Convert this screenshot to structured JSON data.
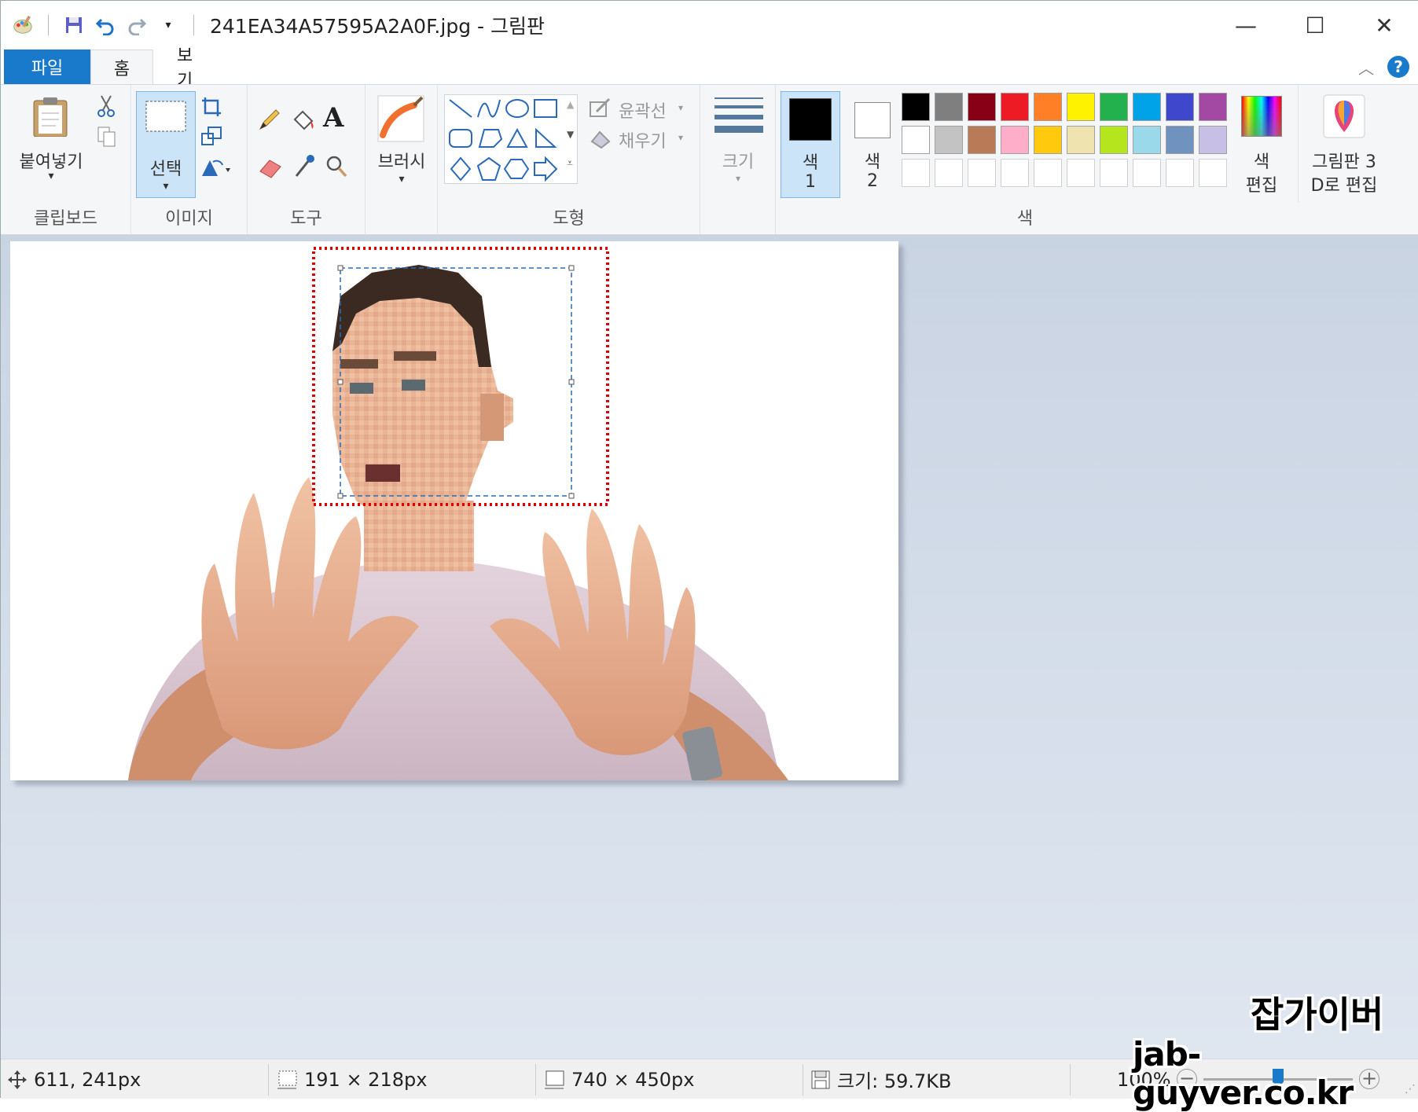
{
  "window": {
    "title": "241EA34A57595A2A0F.jpg - 그림판",
    "minimize": "—",
    "maximize": "☐",
    "close": "✕"
  },
  "tabs": {
    "file": "파일",
    "home": "홈",
    "view": "보기"
  },
  "help": "?",
  "collapse": "︿",
  "ribbon": {
    "clipboard": {
      "paste_label": "붙여넣기",
      "group": "클립보드"
    },
    "image": {
      "select_label": "선택",
      "group": "이미지"
    },
    "tools": {
      "group": "도구"
    },
    "brush": {
      "label": "브러시"
    },
    "shapes": {
      "outline": "윤곽선",
      "fill": "채우기",
      "group": "도형"
    },
    "size": {
      "label": "크기"
    },
    "colors": {
      "color1_label": "색",
      "color1_num": "1",
      "color2_label": "색",
      "color2_num": "2",
      "edit_label_1": "색",
      "edit_label_2": "편집",
      "paint3d_label_1": "그림판 3",
      "paint3d_label_2": "D로 편집",
      "group": "색",
      "color1": "#000000",
      "color2": "#ffffff",
      "palette_row1": [
        "#000000",
        "#7f7f7f",
        "#880015",
        "#ed1c24",
        "#ff7f27",
        "#fff200",
        "#22b14c",
        "#00a2e8",
        "#3f48cc",
        "#a349a4"
      ],
      "palette_row2": [
        "#ffffff",
        "#c3c3c3",
        "#b97a57",
        "#ffaec9",
        "#ffc90e",
        "#efe4b0",
        "#b5e61d",
        "#99d9ea",
        "#7092be",
        "#c8bfe7"
      ],
      "palette_row3": [
        "#ffffff",
        "#ffffff",
        "#ffffff",
        "#ffffff",
        "#ffffff",
        "#ffffff",
        "#ffffff",
        "#ffffff",
        "#ffffff",
        "#ffffff"
      ]
    }
  },
  "statusbar": {
    "cursor_pos": "611, 241px",
    "selection_size": "191 × 218px",
    "image_size": "740 × 450px",
    "file_size": "크기: 59.7KB",
    "zoom": "100%"
  },
  "watermark": {
    "line1": "잡가이버",
    "line2": "jab-guyver.co.kr"
  }
}
